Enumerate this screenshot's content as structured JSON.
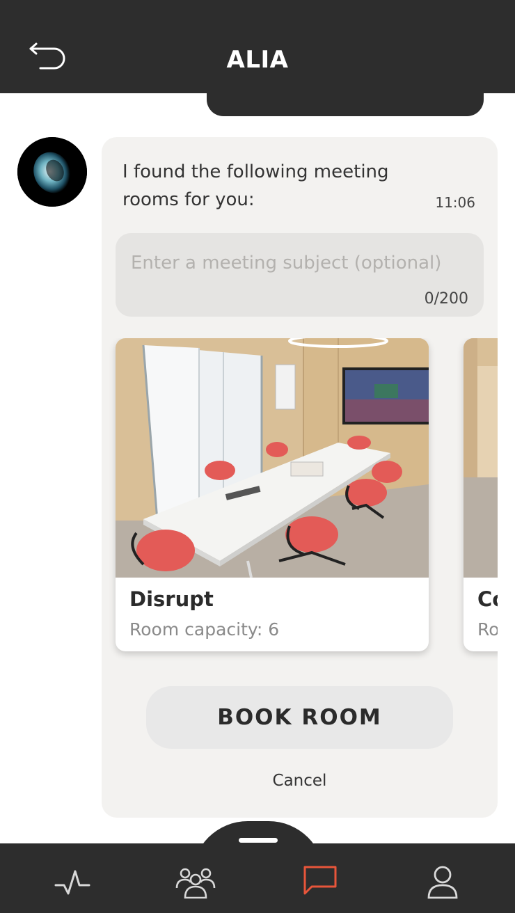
{
  "header": {
    "title": "ALIA",
    "back_icon": "back-arrow-icon"
  },
  "chat": {
    "avatar_icon": "assistant-orb-icon",
    "message": "I found the following meeting rooms for you:",
    "time": "11:06",
    "subject_input": {
      "placeholder": "Enter a meeting subject (optional)",
      "value": "",
      "counter": "0/200"
    },
    "rooms": [
      {
        "name": "Disrupt",
        "capacity": "Room capacity: 6"
      },
      {
        "name": "Co",
        "capacity": "Ro"
      }
    ],
    "book_button": "BOOK ROOM",
    "cancel": "Cancel"
  },
  "tabbar": {
    "items": [
      {
        "icon": "activity-icon",
        "active": false
      },
      {
        "icon": "people-icon",
        "active": false
      },
      {
        "icon": "chat-icon",
        "active": true
      },
      {
        "icon": "profile-icon",
        "active": false
      }
    ],
    "active_color": "#e8553a",
    "inactive_color": "#d9d9d9"
  },
  "colors": {
    "header_bg": "#2d2d2d",
    "bubble_bg": "#f3f2f0",
    "chair_red": "#e35b57"
  }
}
